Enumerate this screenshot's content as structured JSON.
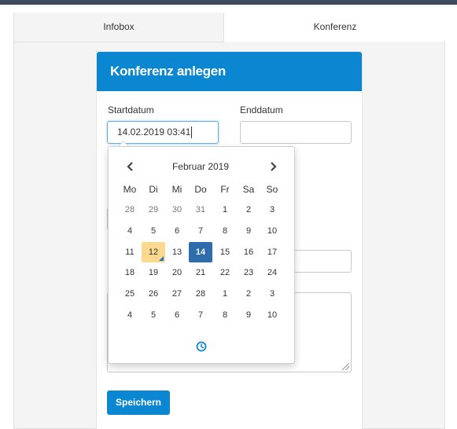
{
  "tabs": [
    {
      "label": "Infobox"
    },
    {
      "label": "Konferenz"
    }
  ],
  "panel": {
    "title": "Konferenz anlegen"
  },
  "fields": {
    "start_label": "Startdatum",
    "start_value": "14.02.2019 03:41",
    "end_label": "Enddatum",
    "end_value": ""
  },
  "datepicker": {
    "month_label": "Februar 2019",
    "weekdays": [
      "Mo",
      "Di",
      "Mi",
      "Do",
      "Fr",
      "Sa",
      "So"
    ],
    "weeks": [
      [
        "28",
        "29",
        "30",
        "31",
        "1",
        "2",
        "3"
      ],
      [
        "4",
        "5",
        "6",
        "7",
        "8",
        "9",
        "10"
      ],
      [
        "11",
        "12",
        "13",
        "14",
        "15",
        "16",
        "17"
      ],
      [
        "18",
        "19",
        "20",
        "21",
        "22",
        "23",
        "24"
      ],
      [
        "25",
        "26",
        "27",
        "28",
        "1",
        "2",
        "3"
      ],
      [
        "4",
        "5",
        "6",
        "7",
        "8",
        "9",
        "10"
      ]
    ],
    "today": "12",
    "selected": "14",
    "icons": {
      "prev": "chevron-left-icon",
      "next": "chevron-right-icon",
      "time": "clock-icon"
    }
  },
  "save_button": "Speichern",
  "colors": {
    "accent": "#0b86d0",
    "selected": "#2e6cab",
    "today": "#fbd98f"
  }
}
